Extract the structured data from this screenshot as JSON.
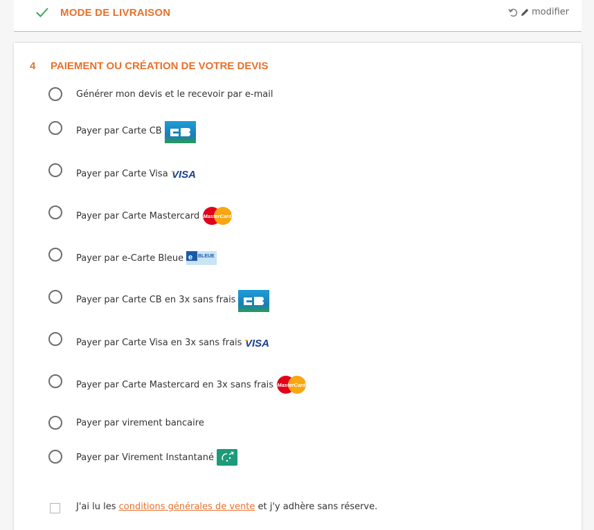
{
  "delivery": {
    "title": "MODE DE LIVRAISON",
    "modify_label": "modifier"
  },
  "payment": {
    "number": "4",
    "title": "PAIEMENT OU CRÉATION DE VOTRE DEVIS",
    "options": [
      {
        "label": "Générer mon devis et le recevoir par e-mail",
        "logo": ""
      },
      {
        "label": "Payer par Carte CB",
        "logo": "cb-logo"
      },
      {
        "label": "Payer par Carte Visa",
        "logo": "visa-logo"
      },
      {
        "label": "Payer par Carte Mastercard",
        "logo": "mastercard-logo"
      },
      {
        "label": "Payer par e-Carte Bleue",
        "logo": "e-carte-bleue-logo"
      },
      {
        "label": "Payer par Carte CB en 3x sans frais",
        "logo": "cb-logo"
      },
      {
        "label": "Payer par Carte Visa en 3x sans frais",
        "logo": "visa-logo"
      },
      {
        "label": "Payer par Carte Mastercard en 3x sans frais",
        "logo": "mastercard-logo"
      },
      {
        "label": "Payer par virement bancaire",
        "logo": ""
      },
      {
        "label": "Payer par Virement Instantané",
        "logo": "instant-transfer-logo"
      }
    ],
    "logo_texts": {
      "mastercard": "MasterCard",
      "visa": "VISA",
      "bleue": "BLEUE",
      "e": "e"
    }
  },
  "terms": {
    "before": "J'ai lu les ",
    "link": "conditions générales de vente",
    "after": " et j'y adhère sans réserve."
  },
  "colors": {
    "accent": "#e8702a",
    "check": "#3aa35b",
    "cb_blue": "#1f9cd8",
    "cb_green": "#2a9a5a",
    "visa_blue": "#1a3f8f"
  }
}
